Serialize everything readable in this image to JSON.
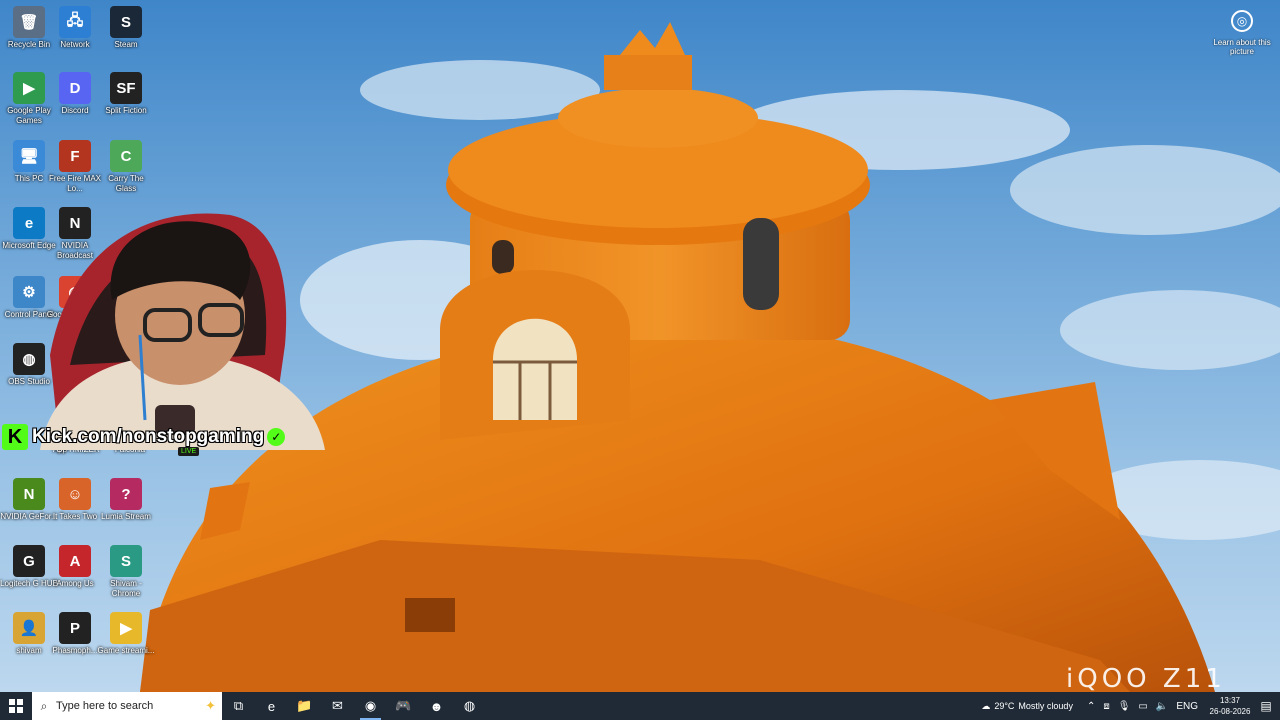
{
  "desktop": {
    "icons": [
      {
        "label": "Recycle Bin",
        "glyph": "🗑",
        "color": "#5a6f85"
      },
      {
        "label": "Network",
        "glyph": "🖧",
        "color": "#2d7fd3"
      },
      {
        "label": "Steam",
        "glyph": "S",
        "color": "#1b2838"
      },
      {
        "label": "Google Play Games",
        "glyph": "▶",
        "color": "#2e9b4e"
      },
      {
        "label": "Discord",
        "glyph": "D",
        "color": "#5865f2"
      },
      {
        "label": "Split Fiction",
        "glyph": "SF",
        "color": "#222"
      },
      {
        "label": "This PC",
        "glyph": "🖥",
        "color": "#3a8ad8"
      },
      {
        "label": "Free Fire MAX Lo...",
        "glyph": "F",
        "color": "#b3341f"
      },
      {
        "label": "Carry The Glass",
        "glyph": "C",
        "color": "#4ea85a"
      },
      {
        "label": "Microsoft Edge",
        "glyph": "e",
        "color": "#0c7ac4"
      },
      {
        "label": "NVIDIA Broadcast",
        "glyph": "N",
        "color": "#222"
      },
      {
        "label": "Control Panel",
        "glyph": "⚙",
        "color": "#3d86c8"
      },
      {
        "label": "Google Chrome",
        "glyph": "◉",
        "color": "#d9432f"
      },
      {
        "label": "OBS Studio",
        "glyph": "◍",
        "color": "#222"
      },
      {
        "label": "NVIDIA GeFor...",
        "glyph": "N",
        "color": "#4a8a1c"
      },
      {
        "label": "It Takes Two",
        "glyph": "☺",
        "color": "#d9642a"
      },
      {
        "label": "Lumia Stream",
        "glyph": "?",
        "color": "#b52b61"
      },
      {
        "label": "Logitech G HUB",
        "glyph": "G",
        "color": "#222"
      },
      {
        "label": "Among Us",
        "glyph": "A",
        "color": "#c5262b"
      },
      {
        "label": "Shivam - Chrome",
        "glyph": "S",
        "color": "#2a9a84"
      },
      {
        "label": "shivam",
        "glyph": "👤",
        "color": "#d8a534"
      },
      {
        "label": "Phasmoph...",
        "glyph": "P",
        "color": "#222"
      },
      {
        "label": "Game streami...",
        "glyph": "▶",
        "color": "#e8b82b"
      }
    ],
    "partial_labels": [
      "App",
      "OPTIMIZER",
      "Falconia"
    ],
    "learn": {
      "label": "Learn about this picture",
      "icon": "camera-icon"
    }
  },
  "overlay": {
    "kick_text": "Kick.com/nonstopgaming",
    "kick_logo": "K",
    "live_badge": "LIVE",
    "watermark": "iQOO Z11"
  },
  "taskbar": {
    "search_placeholder": "Type here to search",
    "apps": [
      {
        "name": "task-view-icon",
        "glyph": "⧉"
      },
      {
        "name": "edge-icon",
        "glyph": "e"
      },
      {
        "name": "file-explorer-icon",
        "glyph": "📁"
      },
      {
        "name": "mail-icon",
        "glyph": "✉"
      },
      {
        "name": "chrome-icon",
        "glyph": "◉"
      },
      {
        "name": "game-icon",
        "glyph": "🎮"
      },
      {
        "name": "notes-icon",
        "glyph": "☻"
      },
      {
        "name": "obs-icon",
        "glyph": "◍"
      }
    ],
    "weather": {
      "temp": "29°C",
      "desc": "Mostly cloudy"
    },
    "lang": "ENG",
    "time": "13:37",
    "date": "26-08-2026"
  },
  "colors": {
    "taskbar": "#1f2a36",
    "kick_green": "#53fc18",
    "sky": "#5d9bd6",
    "dome": "#e67a12"
  }
}
